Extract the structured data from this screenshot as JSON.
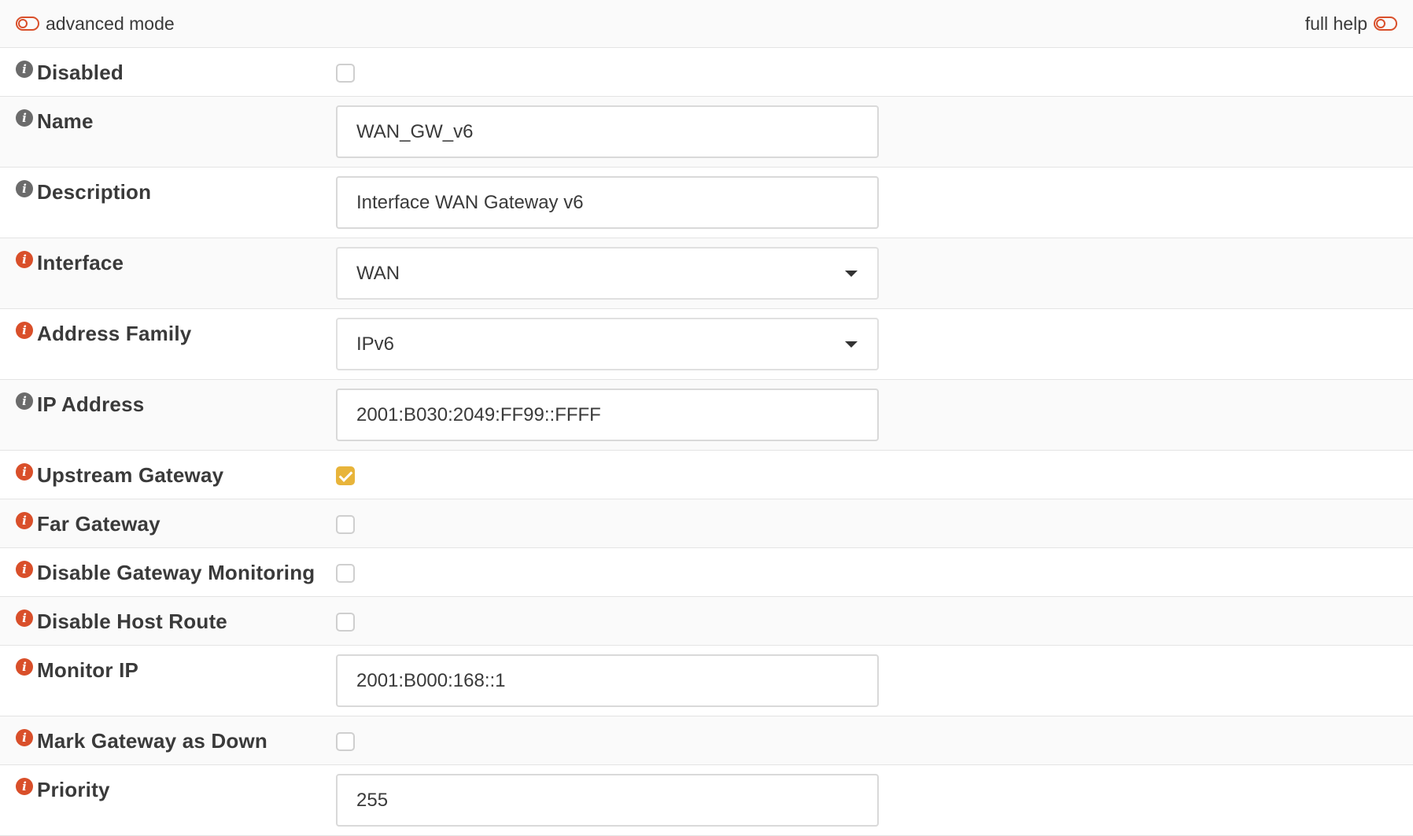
{
  "toolbar": {
    "advanced_mode_label": "advanced mode",
    "full_help_label": "full help"
  },
  "fields": {
    "disabled": {
      "label": "Disabled",
      "checked": false
    },
    "name": {
      "label": "Name",
      "value": "WAN_GW_v6"
    },
    "description": {
      "label": "Description",
      "value": "Interface WAN Gateway v6"
    },
    "interface": {
      "label": "Interface",
      "value": "WAN"
    },
    "address_family": {
      "label": "Address Family",
      "value": "IPv6"
    },
    "ip_address": {
      "label": "IP Address",
      "value": "2001:B030:2049:FF99::FFFF"
    },
    "upstream_gateway": {
      "label": "Upstream Gateway",
      "checked": true
    },
    "far_gateway": {
      "label": "Far Gateway",
      "checked": false
    },
    "disable_gateway_monitoring": {
      "label": "Disable Gateway Monitoring",
      "checked": false
    },
    "disable_host_route": {
      "label": "Disable Host Route",
      "checked": false
    },
    "monitor_ip": {
      "label": "Monitor IP",
      "value": "2001:B000:168::1"
    },
    "mark_gateway_down": {
      "label": "Mark Gateway as Down",
      "checked": false
    },
    "priority": {
      "label": "Priority",
      "value": "255"
    }
  },
  "colors": {
    "info_icon_grey": "#6b6b6b",
    "info_icon_orange": "#d94f2a",
    "checkbox_checked": "#e8b43a",
    "toggle_outline": "#d94f2a"
  },
  "icons": {
    "info": "info-circle-icon",
    "toggle": "toggle-off-icon",
    "caret": "caret-down-icon"
  }
}
